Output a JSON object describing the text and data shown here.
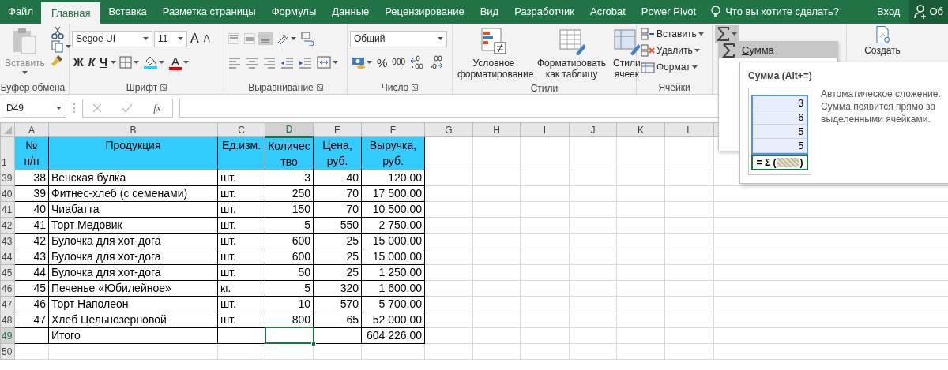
{
  "tabs": [
    {
      "label": "Файл",
      "selected": false
    },
    {
      "label": "Главная",
      "selected": true
    },
    {
      "label": "Вставка",
      "selected": false
    },
    {
      "label": "Разметка страницы",
      "selected": false
    },
    {
      "label": "Формулы",
      "selected": false
    },
    {
      "label": "Данные",
      "selected": false
    },
    {
      "label": "Рецензирование",
      "selected": false
    },
    {
      "label": "Вид",
      "selected": false
    },
    {
      "label": "Разработчик",
      "selected": false
    },
    {
      "label": "Acrobat",
      "selected": false
    },
    {
      "label": "Power Pivot",
      "selected": false
    }
  ],
  "tell_me": "Что вы хотите сделать?",
  "sign_in": "Вход",
  "share": "Об",
  "ribbon": {
    "clipboard": {
      "paste": "Вставить",
      "label": "Буфер обмена"
    },
    "font": {
      "name": "Segoe UI",
      "size": "11",
      "grow": "A",
      "shrink": "A",
      "bold": "Ж",
      "italic": "К",
      "underline": "Ч",
      "font_color": "A",
      "label": "Шрифт"
    },
    "alignment": {
      "vertical": [
        {
          "selected": false
        },
        {
          "selected": false
        },
        {
          "selected": true
        }
      ],
      "label": "Выравнивание"
    },
    "number": {
      "format": "Общий",
      "percent": "%",
      "thousands": "000",
      "label": "Число"
    },
    "styles": {
      "buttons": [
        "Условное форматирование",
        "Форматировать как таблицу",
        "Стили ячеек"
      ],
      "label": "Стили"
    },
    "cells": {
      "buttons": [
        "Вставить",
        "Удалить",
        "Формат"
      ],
      "label": "Ячейки"
    },
    "autosum": {
      "expanded": true
    },
    "adobe": {
      "button": "Создать"
    }
  },
  "formula_bar": {
    "name_box": "D49",
    "function": "fx"
  },
  "sheet": {
    "columns": [
      {
        "label": "A",
        "selected": false
      },
      {
        "label": "B",
        "selected": false
      },
      {
        "label": "C",
        "selected": false
      },
      {
        "label": "D",
        "selected": true
      },
      {
        "label": "E",
        "selected": false
      },
      {
        "label": "F",
        "selected": false
      },
      {
        "label": "G",
        "selected": false
      },
      {
        "label": "H",
        "selected": false
      },
      {
        "label": "I",
        "selected": false
      },
      {
        "label": "J",
        "selected": false
      },
      {
        "label": "K",
        "selected": false
      },
      {
        "label": "L",
        "selected": false
      }
    ],
    "header_row": {
      "number": "1",
      "cells": [
        "№ п/п",
        "Продукция",
        "Ед.изм.",
        "Количество",
        "Цена, руб.",
        "Выручка, руб."
      ]
    },
    "rows": [
      {
        "number": "39",
        "selected": false,
        "cells": [
          "38",
          "Венская булка",
          "шт.",
          "3",
          "40",
          "120,00"
        ]
      },
      {
        "number": "40",
        "selected": false,
        "cells": [
          "39",
          "Фитнес-хлеб (с семенами)",
          "шт.",
          "250",
          "70",
          "17 500,00"
        ]
      },
      {
        "number": "41",
        "selected": false,
        "cells": [
          "40",
          "Чиабатта",
          "шт.",
          "150",
          "70",
          "10 500,00"
        ]
      },
      {
        "number": "42",
        "selected": false,
        "cells": [
          "41",
          "Торт Медовик",
          "шт.",
          "5",
          "550",
          "2 750,00"
        ]
      },
      {
        "number": "43",
        "selected": false,
        "cells": [
          "42",
          "Булочка для хот-дога",
          "шт.",
          "600",
          "25",
          "15 000,00"
        ]
      },
      {
        "number": "44",
        "selected": false,
        "cells": [
          "43",
          "Булочка для хот-дога",
          "шт.",
          "600",
          "25",
          "15 000,00"
        ]
      },
      {
        "number": "45",
        "selected": false,
        "cells": [
          "44",
          "Булочка для хот-дога",
          "шт.",
          "50",
          "25",
          "1 250,00"
        ]
      },
      {
        "number": "46",
        "selected": false,
        "cells": [
          "45",
          "Печенье «Юбилейное»",
          "кг.",
          "5",
          "320",
          "1 600,00"
        ]
      },
      {
        "number": "47",
        "selected": false,
        "cells": [
          "46",
          "Торт Наполеон",
          "шт.",
          "10",
          "570",
          "5 700,00"
        ]
      },
      {
        "number": "48",
        "selected": false,
        "cells": [
          "47",
          "Хлеб Цельнозерновой",
          "шт.",
          "800",
          "65",
          "52 000,00"
        ]
      },
      {
        "number": "49",
        "selected": true,
        "cells": [
          null,
          "Итого",
          null,
          null,
          null,
          "604 226,00"
        ]
      },
      {
        "number": "50",
        "selected": false
      }
    ]
  },
  "autosum_menu": {
    "items": [
      {
        "label": "Сумма",
        "selected": true
      }
    ]
  },
  "tooltip": {
    "title": "Сумма (Alt+=)",
    "example_values": [
      "3",
      "6",
      "5",
      "5"
    ],
    "formula_start": "= Σ (",
    "formula_end": ")",
    "description": "Автоматическое сложение. Сумма появится прямо за выделенными ячейками."
  }
}
